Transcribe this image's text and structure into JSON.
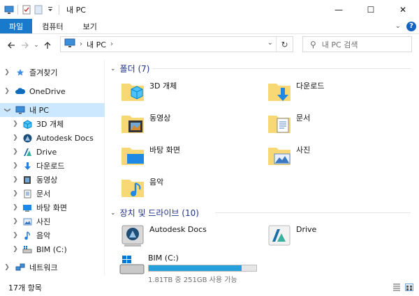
{
  "window": {
    "title": "내 PC",
    "minimize": "—",
    "maximize": "☐",
    "close": "✕"
  },
  "ribbon": {
    "tabs": [
      {
        "label": "파일"
      },
      {
        "label": "컴퓨터"
      },
      {
        "label": "보기"
      }
    ],
    "help_label": "?"
  },
  "address": {
    "crumb": "내 PC",
    "search_placeholder": "내 PC 검색"
  },
  "sidebar": {
    "items": [
      {
        "label": "즐겨찾기",
        "icon": "star-icon"
      },
      {
        "label": "OneDrive",
        "icon": "cloud-icon"
      },
      {
        "label": "내 PC",
        "icon": "pc-icon"
      },
      {
        "label": "3D 개체",
        "icon": "cube-icon"
      },
      {
        "label": "Autodesk Docs",
        "icon": "autodesk-icon"
      },
      {
        "label": "Drive",
        "icon": "drive-a-icon"
      },
      {
        "label": "다운로드",
        "icon": "download-icon"
      },
      {
        "label": "동영상",
        "icon": "video-icon"
      },
      {
        "label": "문서",
        "icon": "document-icon"
      },
      {
        "label": "바탕 화면",
        "icon": "desktop-icon"
      },
      {
        "label": "사진",
        "icon": "picture-icon"
      },
      {
        "label": "음악",
        "icon": "music-icon"
      },
      {
        "label": "BIM (C:)",
        "icon": "disk-icon"
      },
      {
        "label": "네트워크",
        "icon": "network-icon"
      }
    ]
  },
  "main": {
    "folders_header": "폴더 (7)",
    "folders": [
      {
        "label": "3D 개체",
        "icon": "folder-3d-icon"
      },
      {
        "label": "다운로드",
        "icon": "folder-download-icon"
      },
      {
        "label": "동영상",
        "icon": "folder-video-icon"
      },
      {
        "label": "문서",
        "icon": "folder-document-icon"
      },
      {
        "label": "바탕 화면",
        "icon": "folder-desktop-icon"
      },
      {
        "label": "사진",
        "icon": "folder-picture-icon"
      },
      {
        "label": "음악",
        "icon": "folder-music-icon"
      }
    ],
    "devices_header": "장치 및 드라이브 (10)",
    "devices": [
      {
        "label": "Autodesk Docs",
        "icon": "autodesk-drive-icon"
      },
      {
        "label": "Drive",
        "icon": "drive-a-icon"
      },
      {
        "label": "BIM (C:)",
        "icon": "windows-disk-icon",
        "detail": "1.81TB 중 251GB 사용 가능",
        "used_fraction": 0.865
      }
    ]
  },
  "status": {
    "count": "17개 항목"
  },
  "colors": {
    "accent": "#1979ca",
    "selected_bg": "#cce8ff",
    "header_text": "#1e3287",
    "folder": "#f8d775",
    "capacity_bar": "#26a0da"
  }
}
